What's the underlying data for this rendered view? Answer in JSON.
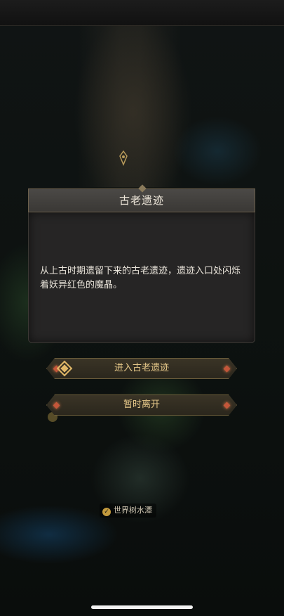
{
  "dialog": {
    "title": "古老遗迹",
    "description": "从上古时期遗留下来的古老遗迹，遗迹入口处闪烁着妖异红色的魔晶。"
  },
  "actions": {
    "enter_label": "进入古老遗迹",
    "leave_label": "暂时离开"
  },
  "map": {
    "location_label": "世界树水潭"
  },
  "colors": {
    "dialog_header": "#3a3835",
    "dialog_body": "#262525",
    "button_text": "#e7c98a",
    "accent_gem": "#c4563a"
  },
  "icons": [
    "ruins-icon",
    "map-marker-icon",
    "check-icon"
  ]
}
